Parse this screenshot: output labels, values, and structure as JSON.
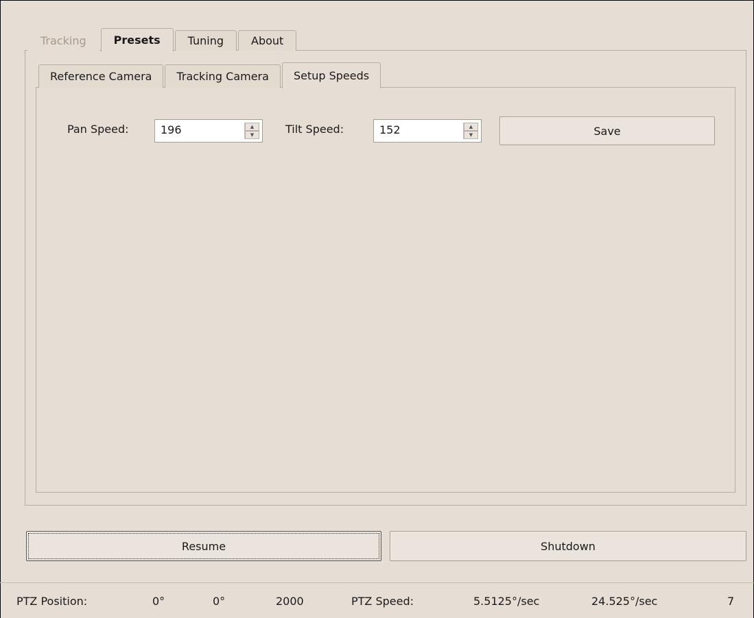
{
  "main_tabs": [
    {
      "label": "Tracking",
      "state": "disabled"
    },
    {
      "label": "Presets",
      "state": "selected"
    },
    {
      "label": "Tuning",
      "state": "normal"
    },
    {
      "label": "About",
      "state": "normal"
    }
  ],
  "preset_tabs": [
    {
      "label": "Reference Camera",
      "state": "normal"
    },
    {
      "label": "Tracking Camera",
      "state": "normal"
    },
    {
      "label": "Setup Speeds",
      "state": "selected"
    }
  ],
  "setup_speeds": {
    "pan_label": "Pan Speed:",
    "pan_value": "196",
    "tilt_label": "Tilt Speed:",
    "tilt_value": "152",
    "save_label": "Save"
  },
  "actions": {
    "resume_label": "Resume",
    "shutdown_label": "Shutdown"
  },
  "status": {
    "position_label": "PTZ Position:",
    "pan": "0°",
    "tilt": "0°",
    "zoom": "2000",
    "speed_label": "PTZ Speed:",
    "pan_speed": "5.5125°/sec",
    "tilt_speed": "24.525°/sec",
    "zoom_speed": "7"
  }
}
